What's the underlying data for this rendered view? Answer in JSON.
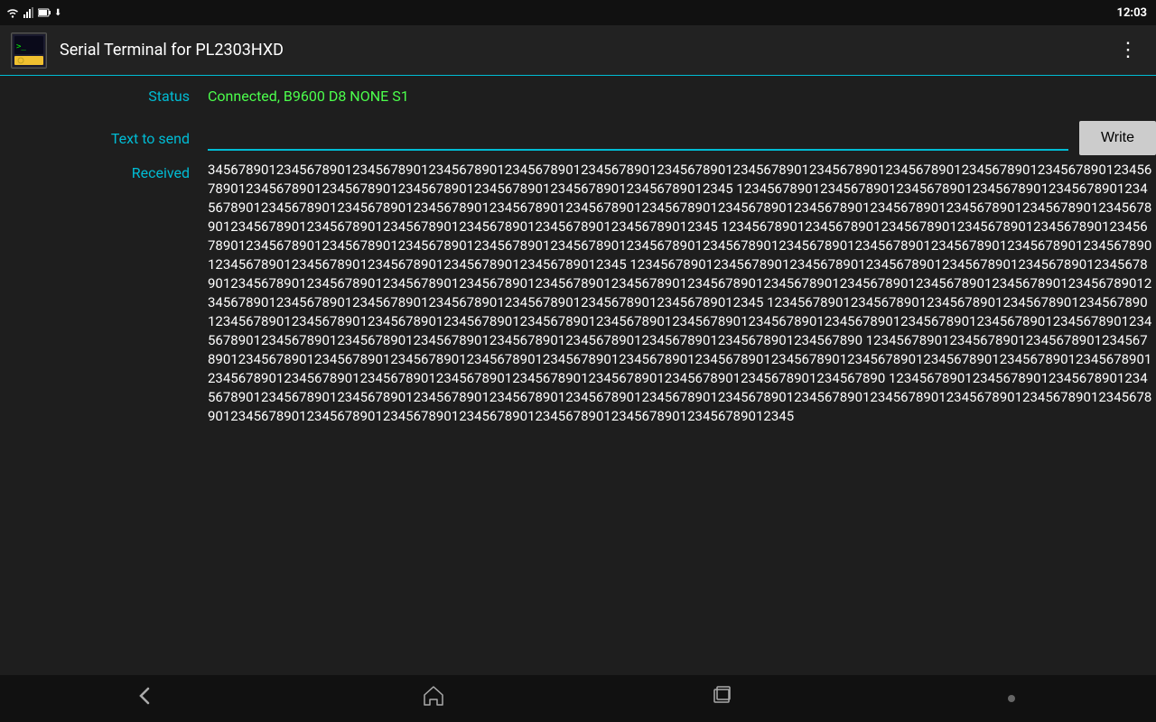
{
  "statusBar": {
    "time": "12:03",
    "icons": [
      "📶",
      "🔋",
      "ℹ"
    ]
  },
  "appBar": {
    "title": "Serial Terminal for PL2303HXD",
    "menuIcon": "⋮"
  },
  "status": {
    "label": "Status",
    "value": "Connected, B9600 D8 NONE S1"
  },
  "textToSend": {
    "label": "Text to send",
    "placeholder": "",
    "buttonLabel": "Write"
  },
  "received": {
    "label": "Received",
    "content": "3456789012345678901234567890123456789012345678901234567890123456789012345678901234567890123456789012345678901234567890123456789012345678901234567890123456789012345678901234567890123456789012345 12345678901234567890123456789012345678901234567890123456789012345678901234567890123456789012345678901234567890123456789012345678901234567890123456789012345678901234567890123456789012345678901234567890123456789012345678901234567890123456789012345 1234567890123456789012345678901234567890123456789012345678901234567890123456789012345678901234567890123456789012345678901234567890123456789012345678901234567890123456789012345678901234567890123456789012345678901234567890123456789012345 1234567890123456789012345678901234567890123456789012345678901234567890123456789012345678901234567890123456789012345678901234567890123456789012345678901234567890123456789012345678901234567890123456789012345678901234567890123456789012345678901234567890123456789012345 12345678901234567890123456789012345678901234567890123456789012345678901234567890123456789012345678901234567890123456789012345678901234567890123456789012345678901234567890123456789012345678901234567890123456789012345678901234567890123456789012345678901234567890 1234567890123456789012345678901234567890123456789012345678901234567890123456789012345678901234567890123456789012345678901234567890123456789012345678901234567890123456789012345678901234567890123456789012345678901234567890123456789012345678901234567890 1234567890123456789012345678901234567890123456789012345678901234567890123456789012345678901234567890123456789012345678901234567890123456789012345678901234567890123456789012345678901234567890123456789012345678901234567890123456789012345"
  },
  "navBar": {
    "backIcon": "↩",
    "homeIcon": "⌂",
    "recentIcon": "☐",
    "dotIcon": "●"
  }
}
